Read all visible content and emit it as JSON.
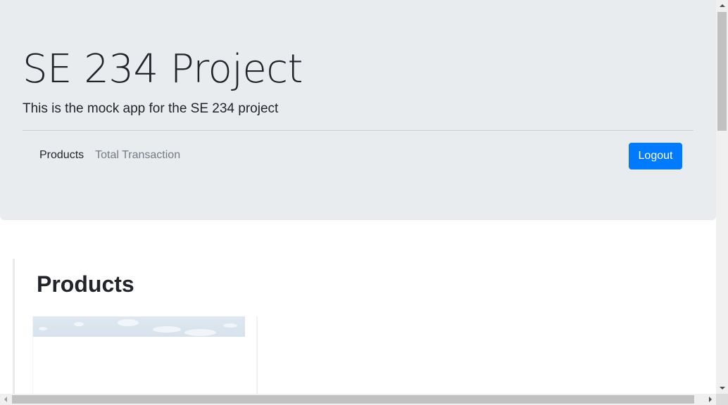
{
  "header": {
    "title": "SE 234 Project",
    "lead": "This is the mock app for the SE 234 project"
  },
  "nav": {
    "items": [
      {
        "label": "Products",
        "active": true
      },
      {
        "label": "Total Transaction",
        "active": false
      }
    ],
    "logout_label": "Logout"
  },
  "main": {
    "heading": "Products"
  },
  "colors": {
    "jumbotron_bg": "#e9ecef",
    "primary": "#007bff",
    "text": "#212529",
    "muted_link": "#757b82"
  },
  "icons": {
    "scroll_up": "triangle-up-icon",
    "scroll_down": "triangle-down-icon",
    "scroll_left": "triangle-left-icon",
    "scroll_right": "triangle-right-icon"
  }
}
